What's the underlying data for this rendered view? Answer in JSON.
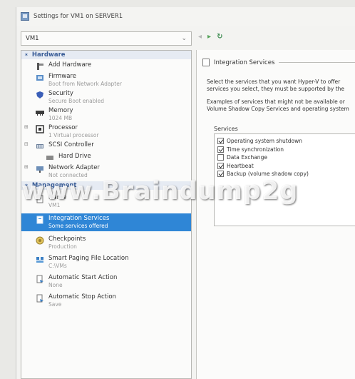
{
  "window": {
    "title": "Settings for VM1 on SERVER1"
  },
  "vm_selector": {
    "value": "VM1"
  },
  "tree": {
    "hardware_section": "Hardware",
    "management_section": "Management",
    "hardware_items": [
      {
        "label": "Add Hardware",
        "sub": "",
        "icon": "add-hardware-icon"
      },
      {
        "label": "Firmware",
        "sub": "Boot from Network Adapter",
        "icon": "firmware-icon"
      },
      {
        "label": "Security",
        "sub": "Secure Boot enabled",
        "icon": "shield-icon"
      },
      {
        "label": "Memory",
        "sub": "1024 MB",
        "icon": "memory-icon"
      },
      {
        "label": "Processor",
        "sub": "1 Virtual processor",
        "icon": "processor-icon"
      },
      {
        "label": "SCSI Controller",
        "sub": "",
        "icon": "scsi-controller-icon"
      },
      {
        "label": "Hard Drive",
        "sub": "",
        "icon": "hard-drive-icon"
      },
      {
        "label": "Network Adapter",
        "sub": "Not connected",
        "icon": "network-adapter-icon"
      }
    ],
    "management_items": [
      {
        "label": "Name",
        "sub": "VM1",
        "icon": "name-icon"
      },
      {
        "label": "Integration Services",
        "sub": "Some services offered",
        "icon": "integration-services-icon"
      },
      {
        "label": "Checkpoints",
        "sub": "Production",
        "icon": "checkpoints-icon"
      },
      {
        "label": "Smart Paging File Location",
        "sub": "C:\\VMs",
        "icon": "smart-paging-icon"
      },
      {
        "label": "Automatic Start Action",
        "sub": "None",
        "icon": "automatic-start-icon"
      },
      {
        "label": "Automatic Stop Action",
        "sub": "Save",
        "icon": "automatic-stop-icon"
      }
    ]
  },
  "pane": {
    "group_title": "Integration Services",
    "desc_line1": "Select the services that you want Hyper-V to offer",
    "desc_line2": "services you select, they must be supported by the",
    "desc_line3": "Examples of services that might not be available or",
    "desc_line4": "Volume Shadow Copy Services and operating system",
    "services_label": "Services",
    "services": [
      {
        "name": "Operating system shutdown",
        "checked": true
      },
      {
        "name": "Time synchronization",
        "checked": true
      },
      {
        "name": "Data Exchange",
        "checked": false
      },
      {
        "name": "Heartbeat",
        "checked": true
      },
      {
        "name": "Backup (volume shadow copy)",
        "checked": true
      }
    ]
  },
  "watermark": {
    "text": "www.Braindump2g"
  }
}
